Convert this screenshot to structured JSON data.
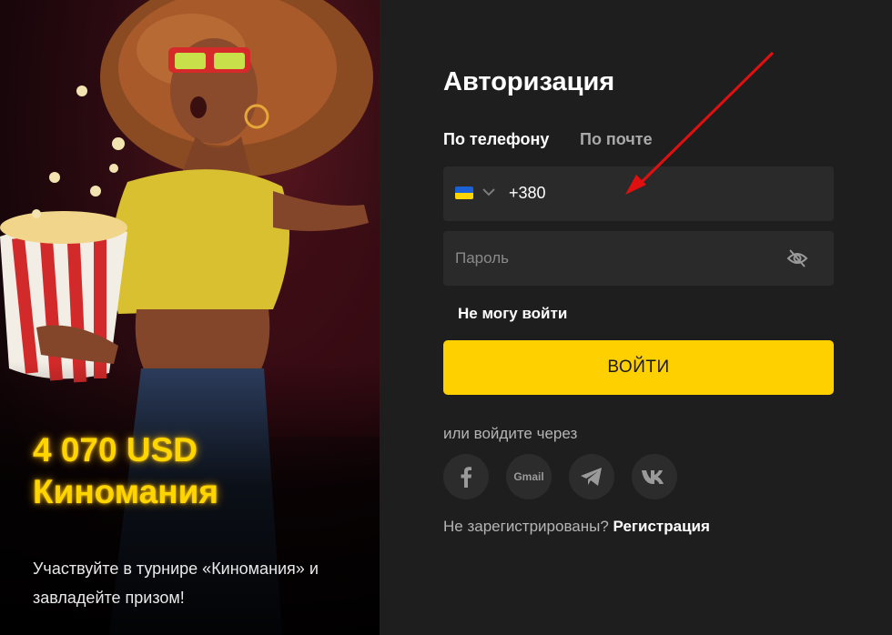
{
  "promo": {
    "amount": "4 070 USD",
    "title": "Киномания",
    "description": "Участвуйте в турнире «Киномания» и завладейте призом!"
  },
  "auth": {
    "title": "Авторизация",
    "tabs": [
      {
        "label": "По телефону",
        "active": true
      },
      {
        "label": "По почте",
        "active": false
      }
    ],
    "phone": {
      "country_flag": "ukraine-flag",
      "code": "+380"
    },
    "password": {
      "placeholder": "Пароль",
      "toggle_icon": "eye-slash-icon"
    },
    "forgot_label": "Не могу войти",
    "login_label": "ВОЙТИ",
    "social": {
      "label": "или войдите через",
      "items": [
        {
          "name": "facebook",
          "icon": "facebook-icon"
        },
        {
          "name": "gmail",
          "label": "Gmail"
        },
        {
          "name": "telegram",
          "icon": "telegram-icon"
        },
        {
          "name": "vk",
          "icon": "vk-icon"
        }
      ]
    },
    "register": {
      "question": "Не зарегистрированы?",
      "link": "Регистрация"
    }
  },
  "colors": {
    "accent": "#ffd000",
    "panel_bg": "#1e1e1e",
    "field_bg": "#2a2a2a",
    "annotation_arrow": "#e01010"
  }
}
